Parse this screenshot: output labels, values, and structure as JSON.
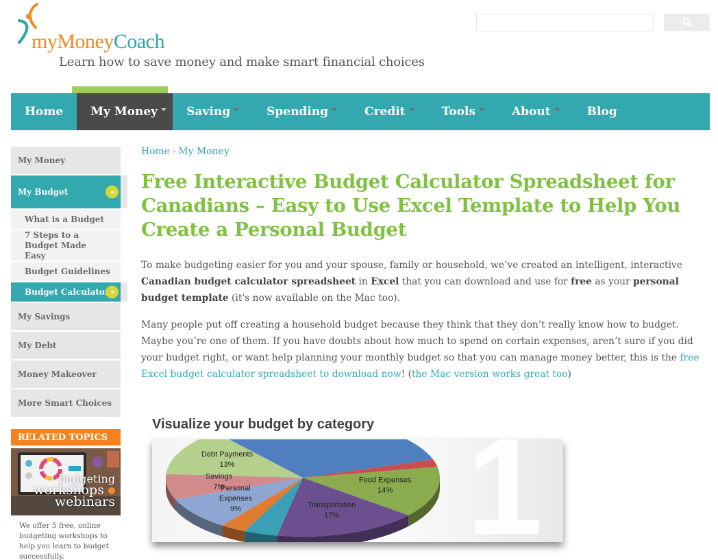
{
  "header": {
    "logo": {
      "part1": "my",
      "part2": "Money",
      "part3": "Coach"
    },
    "tagline": "Learn how to save money and make smart financial choices",
    "search": {
      "placeholder": "",
      "value": "",
      "button_icon": "search-icon"
    }
  },
  "nav": {
    "items": [
      {
        "label": "Home",
        "has_dropdown": false,
        "active": false
      },
      {
        "label": "My Money",
        "has_dropdown": true,
        "active": true
      },
      {
        "label": "Saving",
        "has_dropdown": true,
        "active": false
      },
      {
        "label": "Spending",
        "has_dropdown": true,
        "active": false
      },
      {
        "label": "Credit",
        "has_dropdown": true,
        "active": false
      },
      {
        "label": "Tools",
        "has_dropdown": true,
        "active": false
      },
      {
        "label": "About",
        "has_dropdown": true,
        "active": false
      },
      {
        "label": "Blog",
        "has_dropdown": false,
        "active": false
      }
    ],
    "colors": {
      "bar": "#33a9af",
      "active": "#4a4a4a",
      "active_accent": "#9ccc5a"
    }
  },
  "sidebar": {
    "items": [
      {
        "label": "My Money"
      },
      {
        "label": "My Budget"
      },
      {
        "label": "What is a Budget"
      },
      {
        "label": "7 Steps to a Budget Made Easy"
      },
      {
        "label": "Budget Guidelines"
      },
      {
        "label": "Budget Calculator"
      },
      {
        "label": "My Savings"
      },
      {
        "label": "My Debt"
      },
      {
        "label": "Money Makeover"
      },
      {
        "label": "More Smart Choices"
      }
    ],
    "related": {
      "header": "RELATED TOPICS",
      "image_text": [
        "budgeting",
        "workshops",
        "webinars"
      ],
      "description": "We offer 5 free, online budgeting workshops to help you learn to budget successfully."
    }
  },
  "breadcrumb": {
    "items": [
      "Home",
      "My Money"
    ]
  },
  "page": {
    "title": "Free Interactive Budget Calculator Spreadsheet for Canadians – Easy to Use Excel Template to Help You Create a Personal Budget",
    "p1": {
      "t1": "To make budgeting easier for you and your spouse, family or household, we’ve created an intelligent, interactive ",
      "b1": "Canadian budget calculator spreadsheet",
      "t2": " in ",
      "b2": "Excel",
      "t3": " that you can download and use for ",
      "b3": "free",
      "t4": " as your ",
      "b4": "personal budget template",
      "t5": " (it's now available on the Mac too)."
    },
    "p2": {
      "t1": "Many people put off creating a household budget because they think that they don’t really know how to budget. Maybe you’re one of them. If you have doubts about how much to spend on certain expenses, aren’t sure if you did your budget right, or want help planning your monthly budget so that you can manage money better, this is the ",
      "link1": "free Excel budget calculator spreadsheet to download now",
      "t2": "! (",
      "link2": "the Mac version works great too",
      "t3": ")"
    }
  },
  "chart_data": {
    "type": "pie",
    "title": "Visualize your budget by category",
    "watermark": "1",
    "slices": [
      {
        "label": "Food Expenses",
        "value": 14,
        "color": "#8aab4e",
        "show_label": true
      },
      {
        "label": "Transportation",
        "value": 17,
        "color": "#6c4f8e",
        "show_label": true
      },
      {
        "label": "",
        "value": 4,
        "color": "#3aa0b5",
        "show_label": false
      },
      {
        "label": "",
        "value": 3,
        "color": "#e07b32",
        "show_label": false
      },
      {
        "label": "Personal Expenses",
        "value": 9,
        "color": "#8fa6d2",
        "show_label": true
      },
      {
        "label": "Savings",
        "value": 7,
        "color": "#d38a8a",
        "show_label": true
      },
      {
        "label": "Debt Payments",
        "value": 13,
        "color": "#b5cf8c",
        "show_label": true
      },
      {
        "label": "",
        "value": 31,
        "color": "#4f7fbf",
        "show_label": false
      },
      {
        "label": "",
        "value": 2,
        "color": "#c94f4f",
        "show_label": false
      }
    ]
  }
}
